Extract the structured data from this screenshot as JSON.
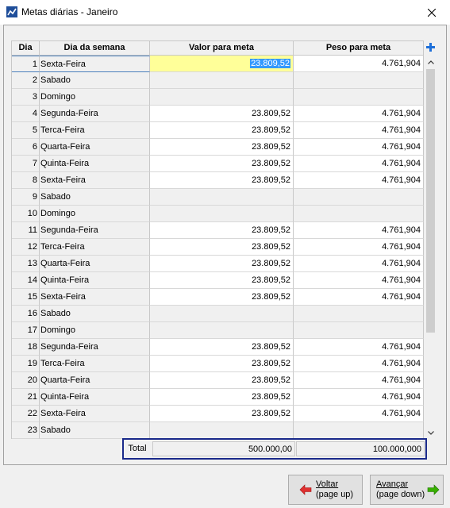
{
  "window": {
    "title": "Metas diárias - Janeiro"
  },
  "columns": {
    "dia": "Dia",
    "dia_semana": "Dia da semana",
    "valor": "Valor para meta",
    "peso": "Peso para meta"
  },
  "rows": [
    {
      "dia": "1",
      "nome": "Sexta-Feira",
      "valor": "23.809,52",
      "peso": "4.761,904"
    },
    {
      "dia": "2",
      "nome": "Sabado",
      "valor": "",
      "peso": ""
    },
    {
      "dia": "3",
      "nome": "Domingo",
      "valor": "",
      "peso": ""
    },
    {
      "dia": "4",
      "nome": "Segunda-Feira",
      "valor": "23.809,52",
      "peso": "4.761,904"
    },
    {
      "dia": "5",
      "nome": "Terca-Feira",
      "valor": "23.809,52",
      "peso": "4.761,904"
    },
    {
      "dia": "6",
      "nome": "Quarta-Feira",
      "valor": "23.809,52",
      "peso": "4.761,904"
    },
    {
      "dia": "7",
      "nome": "Quinta-Feira",
      "valor": "23.809,52",
      "peso": "4.761,904"
    },
    {
      "dia": "8",
      "nome": "Sexta-Feira",
      "valor": "23.809,52",
      "peso": "4.761,904"
    },
    {
      "dia": "9",
      "nome": "Sabado",
      "valor": "",
      "peso": ""
    },
    {
      "dia": "10",
      "nome": "Domingo",
      "valor": "",
      "peso": ""
    },
    {
      "dia": "11",
      "nome": "Segunda-Feira",
      "valor": "23.809,52",
      "peso": "4.761,904"
    },
    {
      "dia": "12",
      "nome": "Terca-Feira",
      "valor": "23.809,52",
      "peso": "4.761,904"
    },
    {
      "dia": "13",
      "nome": "Quarta-Feira",
      "valor": "23.809,52",
      "peso": "4.761,904"
    },
    {
      "dia": "14",
      "nome": "Quinta-Feira",
      "valor": "23.809,52",
      "peso": "4.761,904"
    },
    {
      "dia": "15",
      "nome": "Sexta-Feira",
      "valor": "23.809,52",
      "peso": "4.761,904"
    },
    {
      "dia": "16",
      "nome": "Sabado",
      "valor": "",
      "peso": ""
    },
    {
      "dia": "17",
      "nome": "Domingo",
      "valor": "",
      "peso": ""
    },
    {
      "dia": "18",
      "nome": "Segunda-Feira",
      "valor": "23.809,52",
      "peso": "4.761,904"
    },
    {
      "dia": "19",
      "nome": "Terca-Feira",
      "valor": "23.809,52",
      "peso": "4.761,904"
    },
    {
      "dia": "20",
      "nome": "Quarta-Feira",
      "valor": "23.809,52",
      "peso": "4.761,904"
    },
    {
      "dia": "21",
      "nome": "Quinta-Feira",
      "valor": "23.809,52",
      "peso": "4.761,904"
    },
    {
      "dia": "22",
      "nome": "Sexta-Feira",
      "valor": "23.809,52",
      "peso": "4.761,904"
    },
    {
      "dia": "23",
      "nome": "Sabado",
      "valor": "",
      "peso": ""
    }
  ],
  "total": {
    "label": "Total",
    "valor": "500.000,00",
    "peso": "100.000,000"
  },
  "buttons": {
    "voltar_line1": "Voltar",
    "voltar_line2": "(page up)",
    "avancar_line1": "Avançar",
    "avancar_line2": "(page down)"
  },
  "icons": {
    "app": "chart-icon",
    "close": "close-icon",
    "add": "plus-icon",
    "scroll_up": "chevron-up-icon",
    "scroll_down": "chevron-down-icon",
    "back": "red-arrow-left-icon",
    "forward": "green-arrow-right-icon"
  },
  "colors": {
    "selected_cell": "#ffff99",
    "selection_highlight": "#3399ff",
    "total_border": "#1a2a8a",
    "back_arrow": "#e03030",
    "forward_arrow": "#38b000"
  }
}
